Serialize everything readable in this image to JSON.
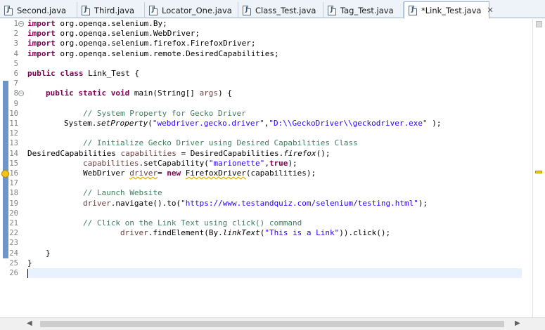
{
  "tabs": [
    {
      "label": "Second.java"
    },
    {
      "label": "Third.java"
    },
    {
      "label": "Locator_One.java"
    },
    {
      "label": "Class_Test.java"
    },
    {
      "label": "Tag_Test.java"
    },
    {
      "label": "*Link_Test.java",
      "active": true
    }
  ],
  "editor": {
    "line_numbers": [
      "1",
      "2",
      "3",
      "4",
      "5",
      "6",
      "7",
      "8",
      "9",
      "10",
      "11",
      "12",
      "13",
      "14",
      "15",
      "16",
      "17",
      "18",
      "19",
      "20",
      "21",
      "22",
      "23",
      "24",
      "25",
      "26"
    ],
    "lines": {
      "l1_kw": "import",
      "l1_rest": " org.openqa.selenium.By;",
      "l2_kw": "import",
      "l2_rest": " org.openqa.selenium.WebDriver;",
      "l3_kw": "import",
      "l3_rest": " org.openqa.selenium.firefox.FirefoxDriver;",
      "l4_kw": "import",
      "l4_rest": " org.openqa.selenium.remote.DesiredCapabilities;",
      "l6_kw": "public class",
      "l6_rest": " Link_Test {",
      "l8_kw": "public static void",
      "l8_a": " main(String[] ",
      "l8_b": "args",
      "l8_c": ") {",
      "l10_cmt": "// System Property for Gecko Driver",
      "l11_a": "System.",
      "l11_b": "setProperty",
      "l11_c": "(",
      "l11_s1": "\"webdriver.gecko.driver\"",
      "l11_d": ",",
      "l11_s2": "\"D:\\\\GeckoDriver\\\\geckodriver.exe\"",
      "l11_e": " );",
      "l13_cmt": "// Initialize Gecko Driver using Desired Capabilities Class",
      "l14_a": "DesiredCapabilities ",
      "l14_b": "capabilities",
      "l14_c": " = DesiredCapabilities.",
      "l14_d": "firefox",
      "l14_e": "();",
      "l15_a": "capabilities",
      "l15_b": ".setCapability(",
      "l15_s": "\"marionette\"",
      "l15_c": ",",
      "l15_kw": "true",
      "l15_d": ");",
      "l16_a": "WebDriver ",
      "l16_b": "driver",
      "l16_c": "= ",
      "l16_kw": "new",
      "l16_d": " ",
      "l16_e": "FirefoxDriver",
      "l16_f": "(capabilities);",
      "l18_cmt": "// Launch Website",
      "l19_a": "driver",
      "l19_b": ".navigate().to(",
      "l19_s": "\"https://www.testandquiz.com/selenium/testing.html\"",
      "l19_c": ");",
      "l21_cmt": "// Click on the Link Text using click() command",
      "l22_a": "driver",
      "l22_b": ".findElement(By.",
      "l22_c": "linkText",
      "l22_d": "(",
      "l22_s": "\"This is a Link\"",
      "l22_e": ")).click();",
      "l24": "}",
      "l25": "}"
    }
  },
  "colors": {
    "keyword": "#7f0055",
    "string": "#2a00ff",
    "comment": "#3f7f5f",
    "field": "#0000c0",
    "current_line": "#e8f2fe",
    "ruler": "#6f95c8",
    "warning": "#f4c21a"
  },
  "icons": {
    "tab_icon": "java-file-icon",
    "close": "close-icon",
    "fold": "fold-toggle-icon",
    "warning": "warning-icon",
    "scroll_left": "arrow-left-icon",
    "scroll_right": "arrow-right-icon"
  }
}
